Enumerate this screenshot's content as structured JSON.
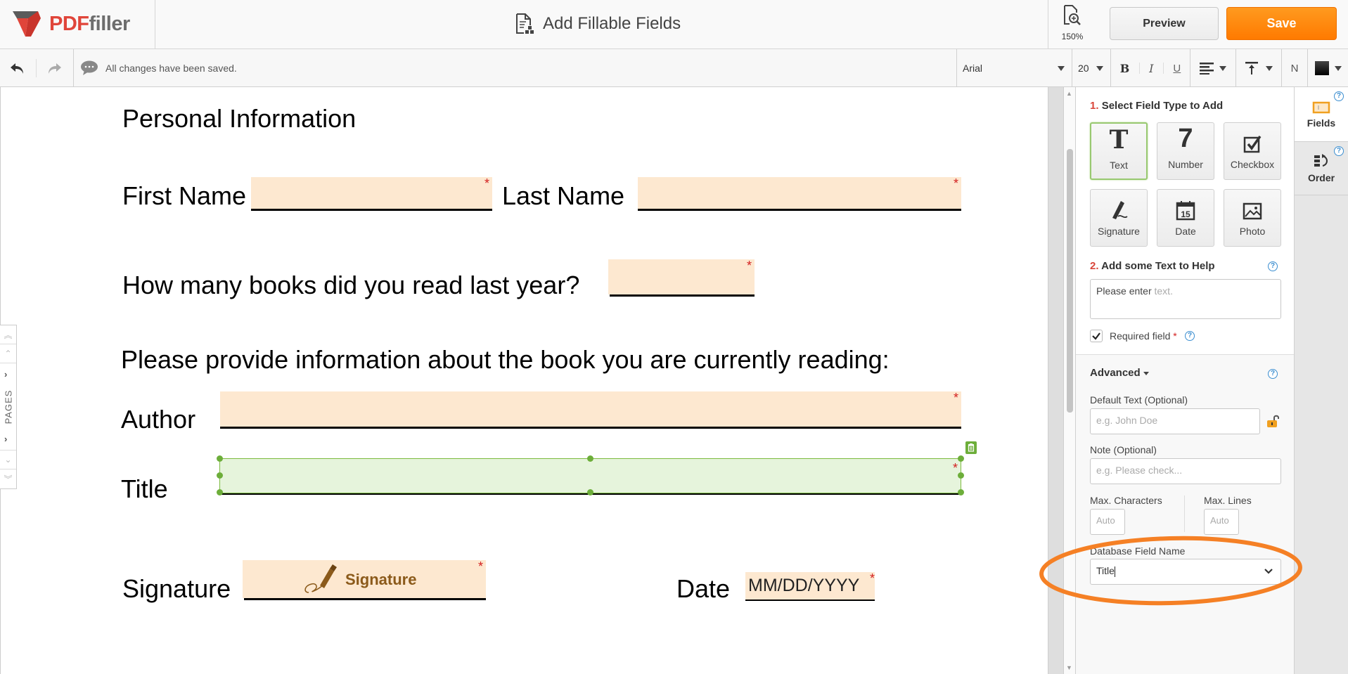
{
  "header": {
    "logo_pdf": "PDF",
    "logo_filler": "filler",
    "title": "Add Fillable Fields",
    "zoom_level": "150%",
    "preview_label": "Preview",
    "save_label": "Save"
  },
  "toolbar": {
    "undo_icon": "undo-icon",
    "redo_icon": "redo-icon",
    "status": "All changes have been saved.",
    "font": "Arial",
    "font_size": "20",
    "bold": "B",
    "italic": "I",
    "underline": "U",
    "normal": "N",
    "text_color": "#000000"
  },
  "document": {
    "heading": "Personal Information",
    "first_name_label": "First Name",
    "last_name_label": "Last Name",
    "books_question": "How many books did you read last year?",
    "book_info_prompt": "Please provide information about the book you are currently reading:",
    "author_label": "Author",
    "title_label": "Title",
    "signature_label": "Signature",
    "signature_field_text": "Signature",
    "date_label": "Date",
    "date_placeholder": "MM/DD/YYYY",
    "required_marker": "*"
  },
  "pages_tab": {
    "label": "PAGES"
  },
  "panel": {
    "step1_num": "1.",
    "step1_title": "Select Field Type to Add",
    "field_types": [
      {
        "label": "Text",
        "icon": "text-icon",
        "active": true
      },
      {
        "label": "Number",
        "icon": "number-icon",
        "active": false
      },
      {
        "label": "Checkbox",
        "icon": "checkbox-icon",
        "active": false
      },
      {
        "label": "Signature",
        "icon": "signature-icon",
        "active": false
      },
      {
        "label": "Date",
        "icon": "calendar-icon",
        "active": false
      },
      {
        "label": "Photo",
        "icon": "photo-icon",
        "active": false
      }
    ],
    "step2_num": "2.",
    "step2_title": "Add some Text to Help",
    "help_text_prefix": "Please enter ",
    "help_text_placeholder": "text.",
    "required_label": "Required field",
    "required_checked": true,
    "advanced_label": "Advanced",
    "default_text_label": "Default Text (Optional)",
    "default_text_placeholder": "e.g. John Doe",
    "note_label": "Note (Optional)",
    "note_placeholder": "e.g. Please check...",
    "max_chars_label": "Max. Characters",
    "max_chars_placeholder": "Auto",
    "max_lines_label": "Max. Lines",
    "max_lines_placeholder": "Auto",
    "db_field_label": "Database Field Name",
    "db_field_value": "Title"
  },
  "tabs": [
    {
      "label": "Fields",
      "active": true
    },
    {
      "label": "Order",
      "active": false
    }
  ],
  "colors": {
    "accent_orange": "#ff8200",
    "brand_red": "#e0453a",
    "field_fill": "#fde8d0",
    "selected_field_fill": "#e6f4dc",
    "selected_border": "#7cbb3f",
    "help_blue": "#3b8ed0"
  }
}
